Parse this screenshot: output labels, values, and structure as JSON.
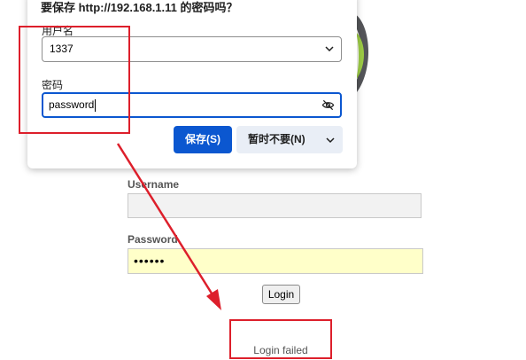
{
  "popup": {
    "title": "要保存 http://192.168.1.11 的密码吗？",
    "username_label": "用户名",
    "username_value": "1337",
    "password_label": "密码",
    "password_value": "password",
    "save_button": "保存(S)",
    "never_button": "暂时不要(N)",
    "icons": {
      "username_dropdown": "chevron-down-icon",
      "password_reveal": "eye-off-icon",
      "never_dropdown": "chevron-down-icon"
    }
  },
  "login": {
    "username_label": "Username",
    "username_value": "",
    "password_label": "Password",
    "password_value": "••••••",
    "login_button": "Login",
    "status_message": "Login failed"
  },
  "colors": {
    "accent": "#0b57d0",
    "annotation": "#dd1f2b",
    "autofill_bg": "#ffffc9",
    "logo_green": "#9ccb45",
    "logo_gray": "#545559"
  }
}
